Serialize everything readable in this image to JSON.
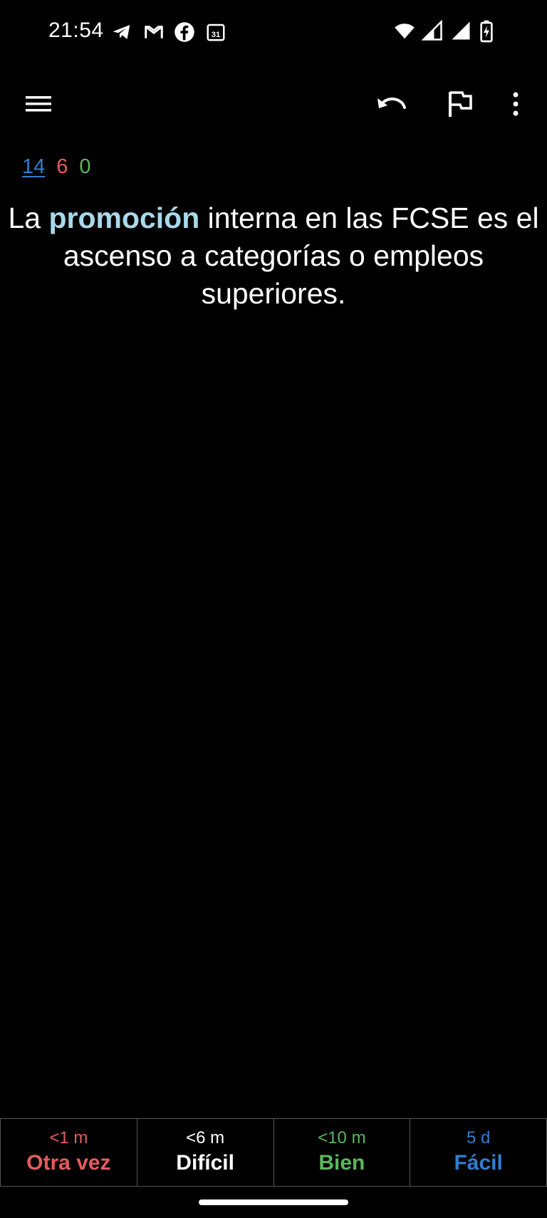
{
  "status_bar": {
    "time": "21:54",
    "left_icons": [
      "telegram-icon",
      "gmail-icon",
      "facebook-icon",
      "calendar-icon"
    ],
    "calendar_day": "31",
    "right_icons": [
      "wifi-icon",
      "signal-icon",
      "signal-icon",
      "battery-charging-icon"
    ]
  },
  "toolbar": {
    "icons": [
      "menu-icon",
      "undo-icon",
      "flag-icon",
      "more-vert-icon"
    ]
  },
  "counts": {
    "new": "14",
    "learning": "6",
    "review": "0"
  },
  "card": {
    "prefix": "La ",
    "highlight": "promoción",
    "suffix": " interna en las FCSE es el ascenso a categorías o empleos superiores."
  },
  "answers": [
    {
      "time": "<1 m",
      "label": "Otra vez"
    },
    {
      "time": "<6 m",
      "label": "Difícil"
    },
    {
      "time": "<10 m",
      "label": "Bien"
    },
    {
      "time": "5 d",
      "label": "Fácil"
    }
  ],
  "colors": {
    "again": "#e35d5b",
    "hard": "#ffffff",
    "good": "#5cb85c",
    "easy": "#2e7fd1",
    "highlight": "#a9d8ea"
  }
}
